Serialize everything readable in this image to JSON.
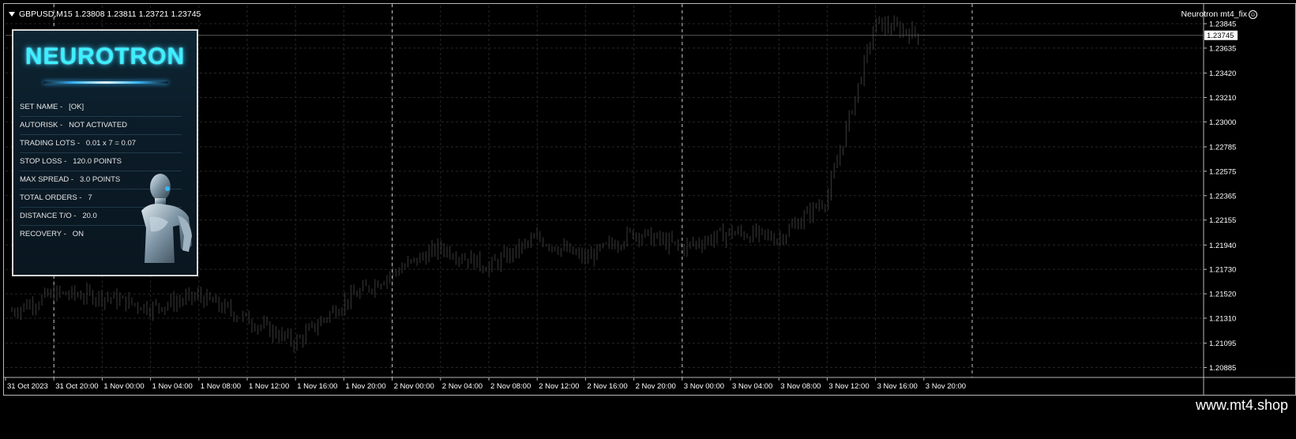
{
  "symbol_label": "GBPUSD,M15  1.23808 1.23811 1.23721 1.23745",
  "ea_label": "Neurotron mt4_fix",
  "ea_icon": "smiley-icon",
  "panel": {
    "title": "NEUROTRON",
    "rows": [
      "SET NAME -   [OK]",
      "AUTORISK -   NOT ACTIVATED",
      "TRADING LOTS -   0.01 x 7 = 0.07",
      "STOP LOSS -   120.0 POINTS",
      "MAX SPREAD -   3.0 POINTS",
      "TOTAL ORDERS -   7",
      "DISTANCE T/O -   20.0",
      "RECOVERY -   ON"
    ]
  },
  "current_price": "1.23745",
  "price_ticks": [
    "1.23845",
    "1.23635",
    "1.23420",
    "1.23210",
    "1.23000",
    "1.22785",
    "1.22575",
    "1.22365",
    "1.22155",
    "1.21940",
    "1.21730",
    "1.21520",
    "1.21310",
    "1.21095",
    "1.20885"
  ],
  "time_ticks": [
    "31 Oct 2023",
    "31 Oct 20:00",
    "1 Nov 00:00",
    "1 Nov 04:00",
    "1 Nov 08:00",
    "1 Nov 12:00",
    "1 Nov 16:00",
    "1 Nov 20:00",
    "2 Nov 00:00",
    "2 Nov 04:00",
    "2 Nov 08:00",
    "2 Nov 12:00",
    "2 Nov 16:00",
    "2 Nov 20:00",
    "3 Nov 00:00",
    "3 Nov 04:00",
    "3 Nov 08:00",
    "3 Nov 12:00",
    "3 Nov 16:00",
    "3 Nov 20:00"
  ],
  "watermark": "www.mt4.shop",
  "colors": {
    "background": "#000000",
    "grid": "#262626",
    "candles": "#3a3a3a",
    "panel_title": "#3ef0ff",
    "text": "#ffffff"
  },
  "chart_data": {
    "type": "candlestick",
    "y_range": [
      1.208,
      1.2392
    ],
    "close_path": [
      [
        "31 Oct 2023",
        1.2135
      ],
      [
        "31 Oct 20:00",
        1.2152
      ],
      [
        "1 Nov 00:00",
        1.215
      ],
      [
        "1 Nov 04:00",
        1.214
      ],
      [
        "1 Nov 08:00",
        1.215
      ],
      [
        "1 Nov 12:00",
        1.213
      ],
      [
        "1 Nov 16:00",
        1.211
      ],
      [
        "1 Nov 20:00",
        1.2145
      ],
      [
        "2 Nov 00:00",
        1.217
      ],
      [
        "2 Nov 04:00",
        1.2192
      ],
      [
        "2 Nov 08:00",
        1.2175
      ],
      [
        "2 Nov 12:00",
        1.22
      ],
      [
        "2 Nov 16:00",
        1.2182
      ],
      [
        "2 Nov 20:00",
        1.2205
      ],
      [
        "3 Nov 00:00",
        1.2192
      ],
      [
        "3 Nov 04:00",
        1.2205
      ],
      [
        "3 Nov 08:00",
        1.22
      ],
      [
        "3 Nov 12:00",
        1.2235
      ],
      [
        "3 Nov 16:00",
        1.2385
      ],
      [
        "3 Nov 20:00",
        1.23745
      ]
    ]
  }
}
